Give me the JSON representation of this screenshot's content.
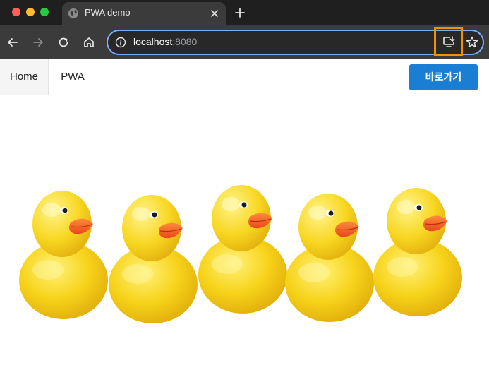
{
  "window": {
    "traffic_lights": {
      "close": "#ff5f57",
      "minimize": "#febc2e",
      "zoom": "#28c840"
    }
  },
  "tabs": [
    {
      "title": "PWA demo",
      "icon": "globe-icon",
      "active": true
    }
  ],
  "toolbar": {
    "back_icon": "arrow-left-icon",
    "forward_icon": "arrow-right-icon",
    "reload_icon": "reload-icon",
    "home_icon": "home-icon",
    "install_icon": "install-app-icon",
    "bookmark_icon": "star-icon",
    "install_highlight_color": "#f29100"
  },
  "omnibox": {
    "host": "localhost",
    "port": ":8080",
    "focus_color": "#7cacf8"
  },
  "page": {
    "nav": [
      {
        "label": "Home",
        "active": true
      },
      {
        "label": "PWA",
        "active": false
      }
    ],
    "cta_label": "바로가기",
    "cta_color": "#1a7fd4",
    "hero_image": {
      "subject": "rubber-ducks",
      "count": 5,
      "color": "#f7d31a"
    }
  }
}
